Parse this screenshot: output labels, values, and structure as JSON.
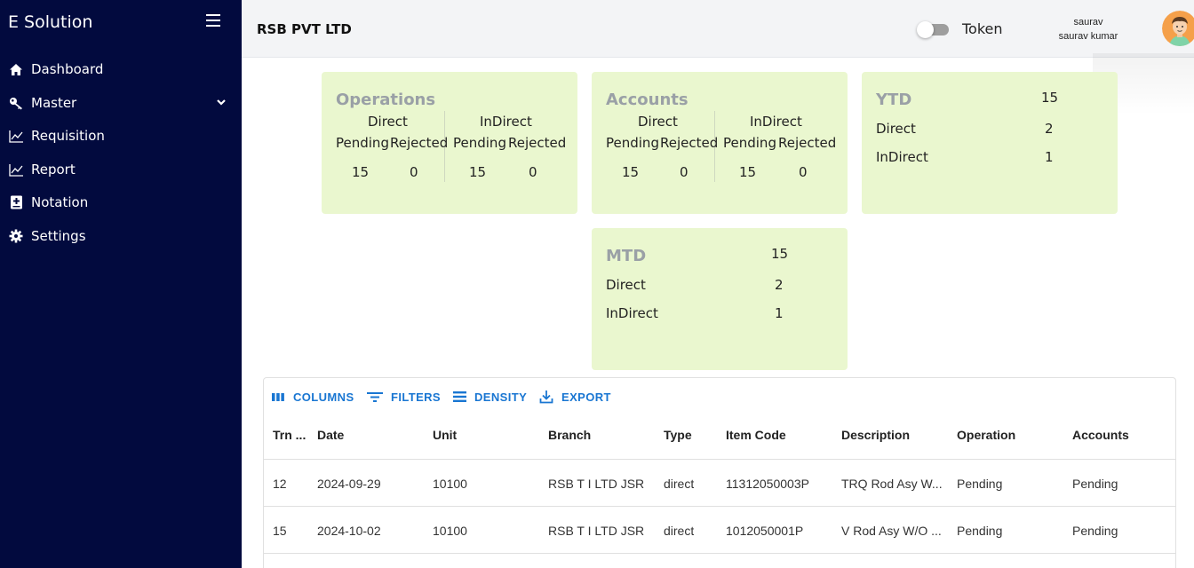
{
  "sidebar": {
    "brand": "E Solution",
    "items": [
      {
        "label": "Dashboard",
        "icon": "home-icon"
      },
      {
        "label": "Master",
        "icon": "key-icon"
      },
      {
        "label": "Requisition",
        "icon": "chart-line-icon"
      },
      {
        "label": "Report",
        "icon": "chart-line-icon"
      },
      {
        "label": "Notation",
        "icon": "notation-icon"
      },
      {
        "label": "Settings",
        "icon": "gear-icon"
      }
    ],
    "colors": {
      "background": "#020a3e"
    }
  },
  "header": {
    "company": "RSB PVT LTD",
    "token_label": "Token",
    "user_short": "saurav",
    "user_full": "saurav kumar"
  },
  "cards": {
    "operations": {
      "title": "Operations",
      "direct_label": "Direct",
      "indirect_label": "InDirect",
      "pending_label": "Pending",
      "rejected_label": "Rejected",
      "direct_pending": "15",
      "direct_rejected": "0",
      "indirect_pending": "15",
      "indirect_rejected": "0"
    },
    "accounts": {
      "title": "Accounts",
      "direct_label": "Direct",
      "indirect_label": "InDirect",
      "pending_label": "Pending",
      "rejected_label": "Rejected",
      "direct_pending": "15",
      "direct_rejected": "0",
      "indirect_pending": "15",
      "indirect_rejected": "0"
    },
    "ytd": {
      "title": "YTD",
      "total": "15",
      "direct_label": "Direct",
      "direct_value": "2",
      "indirect_label": "InDirect",
      "indirect_value": "1"
    },
    "mtd": {
      "title": "MTD",
      "total": "15",
      "direct_label": "Direct",
      "direct_value": "2",
      "indirect_label": "InDirect",
      "indirect_value": "1"
    },
    "colors": {
      "background": "#eaf7cf",
      "title": "#9aa0a6"
    }
  },
  "grid": {
    "toolbar": {
      "columns": "COLUMNS",
      "filters": "FILTERS",
      "density": "DENSITY",
      "export": "EXPORT"
    },
    "headers": [
      "Trn ...",
      "Date",
      "Unit",
      "Branch",
      "Type",
      "Item Code",
      "Description",
      "Operation",
      "Accounts"
    ],
    "rows": [
      [
        "12",
        "2024-09-29",
        "10100",
        "RSB T I LTD JSR",
        "direct",
        "11312050003P",
        "TRQ Rod Asy W...",
        "Pending",
        "Pending"
      ],
      [
        "15",
        "2024-10-02",
        "10100",
        "RSB T I LTD JSR",
        "direct",
        "1012050001P",
        "V Rod Asy W/O ...",
        "Pending",
        "Pending"
      ]
    ],
    "colors": {
      "accent": "#1976d2"
    }
  }
}
